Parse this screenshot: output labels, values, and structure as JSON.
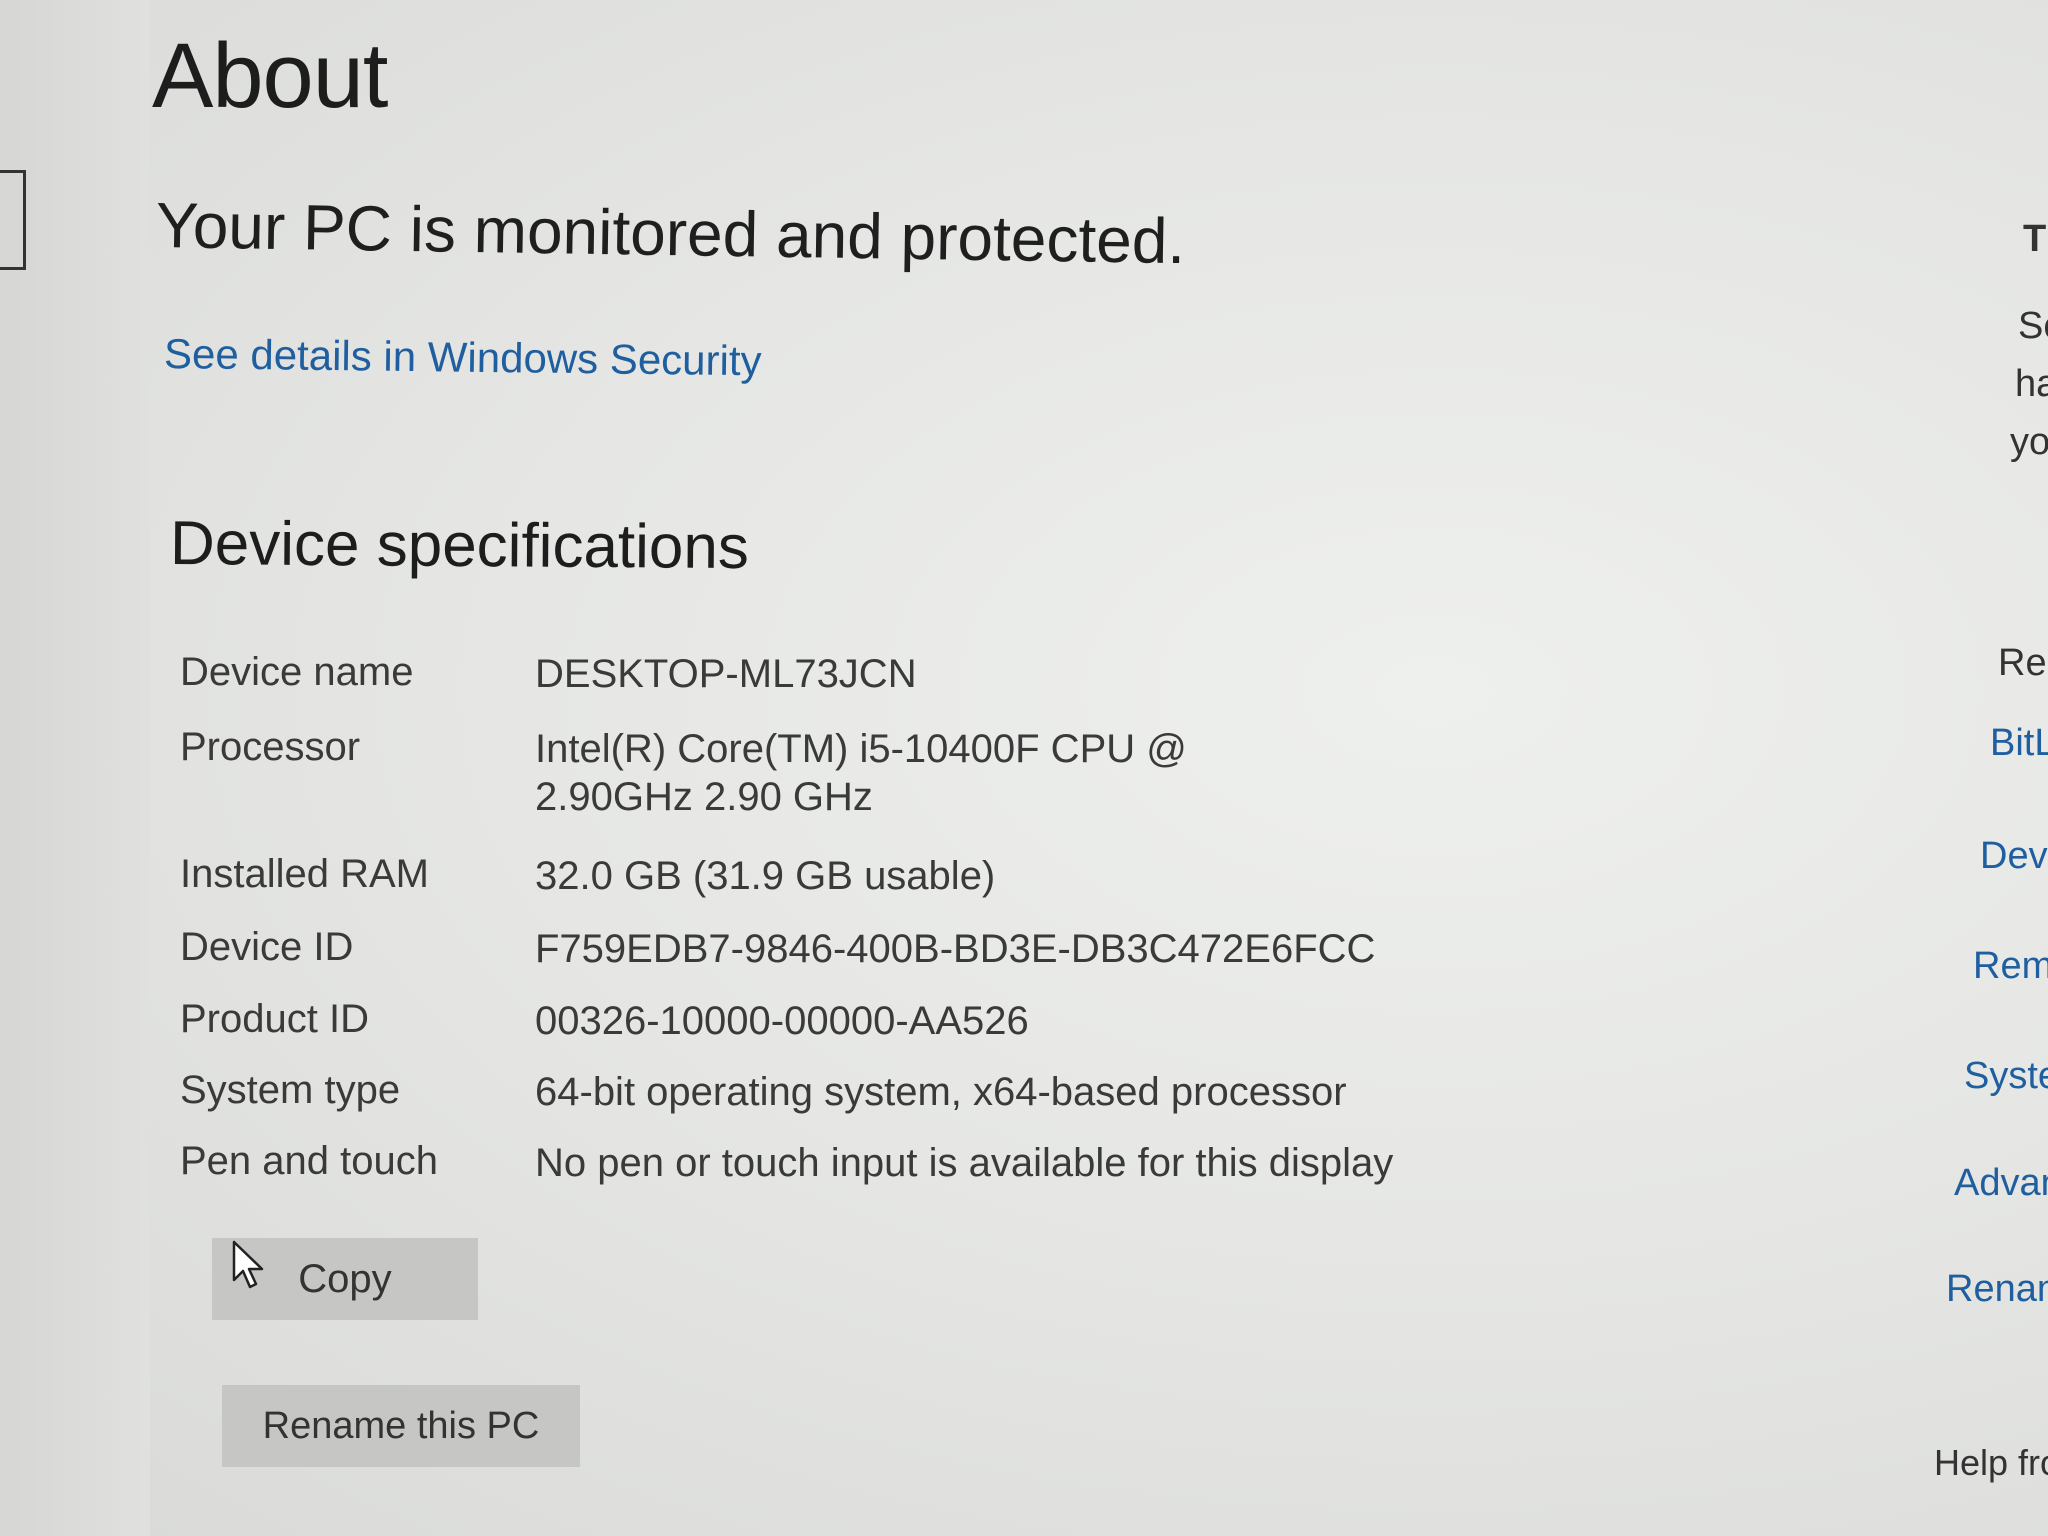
{
  "page": {
    "title": "About",
    "protection_heading": "Your PC is monitored and protected.",
    "security_link": "See details in Windows Security"
  },
  "specs": {
    "section_title": "Device specifications",
    "rows": [
      {
        "label": "Device name",
        "value": "DESKTOP-ML73JCN"
      },
      {
        "label": "Processor",
        "value": "Intel(R) Core(TM) i5-10400F CPU @ 2.90GHz   2.90 GHz"
      },
      {
        "label": "Installed RAM",
        "value": "32.0 GB (31.9 GB usable)"
      },
      {
        "label": "Device ID",
        "value": "F759EDB7-9846-400B-BD3E-DB3C472E6FCC"
      },
      {
        "label": "Product ID",
        "value": "00326-10000-00000-AA526"
      },
      {
        "label": "System type",
        "value": "64-bit operating system, x64-based processor"
      },
      {
        "label": "Pen and touch",
        "value": "No pen or touch input is available for this display"
      }
    ],
    "copy_button": "Copy",
    "rename_button": "Rename this PC"
  },
  "right_panel": {
    "t": "Ti",
    "s1": "Sc",
    "s2": "ha",
    "s3": "yo",
    "related": "Rela",
    "bitlocker": "BitLo",
    "device": "Devic",
    "remote": "Remo",
    "system": "Systen",
    "advanced": "Advanc",
    "rename": "Rename",
    "help": "Help fron"
  },
  "icons": {
    "cursor": "mouse-pointer-icon"
  }
}
